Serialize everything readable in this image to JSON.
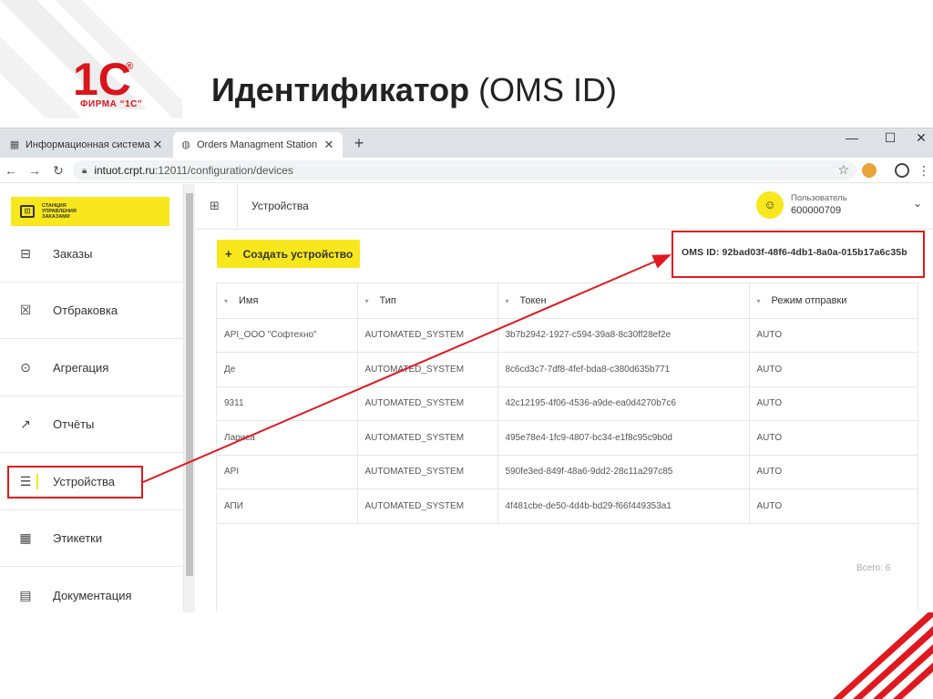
{
  "slide": {
    "title_bold": "Идентификатор",
    "title_rest": " (OMS ID)",
    "logo_text": "1С",
    "logo_sub": "ФИРМА “1С”"
  },
  "browser": {
    "tabs": [
      {
        "label": "Информационная система мар",
        "icon": "qr-icon"
      },
      {
        "label": "Orders Managment Station",
        "icon": "globe-icon"
      }
    ],
    "new_tab": "+",
    "url_host": "intuot.crpt.ru",
    "url_path": ":12011/configuration/devices",
    "window_controls": [
      "—",
      "☐",
      "✕"
    ]
  },
  "app": {
    "brand_text": "СТАНЦИЯ\nУПРАВЛЕНИЯ\nЗАКАЗАМИ",
    "nav": [
      {
        "label": "Заказы",
        "icon": "briefcase-icon",
        "glyph": "⊟"
      },
      {
        "label": "Отбраковка",
        "icon": "reject-icon",
        "glyph": "☒"
      },
      {
        "label": "Агрегация",
        "icon": "aggregation-icon",
        "glyph": "⊙"
      },
      {
        "label": "Отчёты",
        "icon": "chart-icon",
        "glyph": "↗"
      },
      {
        "label": "Устройства",
        "icon": "devices-icon",
        "glyph": "☰"
      },
      {
        "label": "Этикетки",
        "icon": "qrcode-icon",
        "glyph": "▦"
      },
      {
        "label": "Документация",
        "icon": "document-icon",
        "glyph": "▤"
      }
    ],
    "active_nav_index": 4,
    "page_title": "Устройства",
    "user_role": "Пользователь",
    "user_id": "600000709",
    "create_button": "Создать устройство",
    "oms_id": "OMS ID: 92bad03f-48f6-4db1-8a0a-015b17a6c35b",
    "table": {
      "columns": [
        "Имя",
        "Тип",
        "Токен",
        "Режим отправки"
      ],
      "rows": [
        [
          "API_ООО \"Софтехно\"",
          "AUTOMATED_SYSTEM",
          "3b7b2942-1927-c594-39a8-8c30ff28ef2e",
          "AUTO"
        ],
        [
          "Де",
          "AUTOMATED_SYSTEM",
          "8c6cd3c7-7df8-4fef-bda8-c380d635b771",
          "AUTO"
        ],
        [
          "9311",
          "AUTOMATED_SYSTEM",
          "42c12195-4f06-4536-a9de-ea0d4270b7c6",
          "AUTO"
        ],
        [
          "Лариса",
          "AUTOMATED_SYSTEM",
          "495e78e4-1fc9-4807-bc34-e1f8c95c9b0d",
          "AUTO"
        ],
        [
          "API",
          "AUTOMATED_SYSTEM",
          "590fe3ed-849f-48a6-9dd2-28c11a297c85",
          "AUTO"
        ],
        [
          "АПИ",
          "AUTOMATED_SYSTEM",
          "4f481cbe-de50-4d4b-bd29-f66f449353a1",
          "AUTO"
        ]
      ]
    },
    "total": "Всего: 6"
  },
  "colors": {
    "accent_yellow": "#f8e71c",
    "annotation_red": "#e0181f",
    "brand_red": "#d8151b"
  }
}
